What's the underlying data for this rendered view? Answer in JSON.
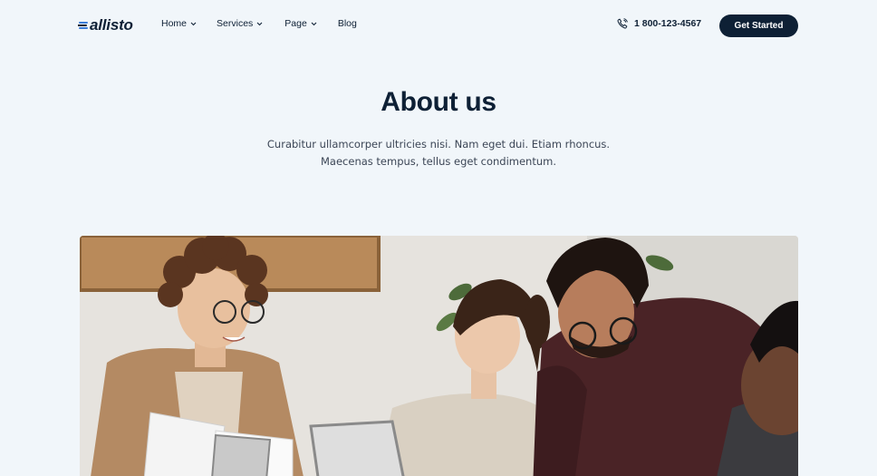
{
  "brand": {
    "name": "Callisto",
    "logo_text": "allisto"
  },
  "nav": {
    "items": [
      {
        "label": "Home",
        "has_dropdown": true
      },
      {
        "label": "Services",
        "has_dropdown": true
      },
      {
        "label": "Page",
        "has_dropdown": true
      },
      {
        "label": "Blog",
        "has_dropdown": false
      }
    ]
  },
  "header": {
    "phone": "1 800-123-4567",
    "cta_label": "Get Started"
  },
  "hero": {
    "title": "About us",
    "subtitle_line1": "Curabitur ullamcorper ultricies nisi. Nam eget dui. Etiam rhoncus.",
    "subtitle_line2": "Maecenas tempus, tellus eget condimentum."
  },
  "colors": {
    "background": "#f1f6fa",
    "primary": "#0e2035",
    "accent": "#3b7dd8"
  },
  "icons": {
    "logo": "logo-mark-icon",
    "dropdown": "chevron-down-icon",
    "phone": "phone-icon"
  }
}
